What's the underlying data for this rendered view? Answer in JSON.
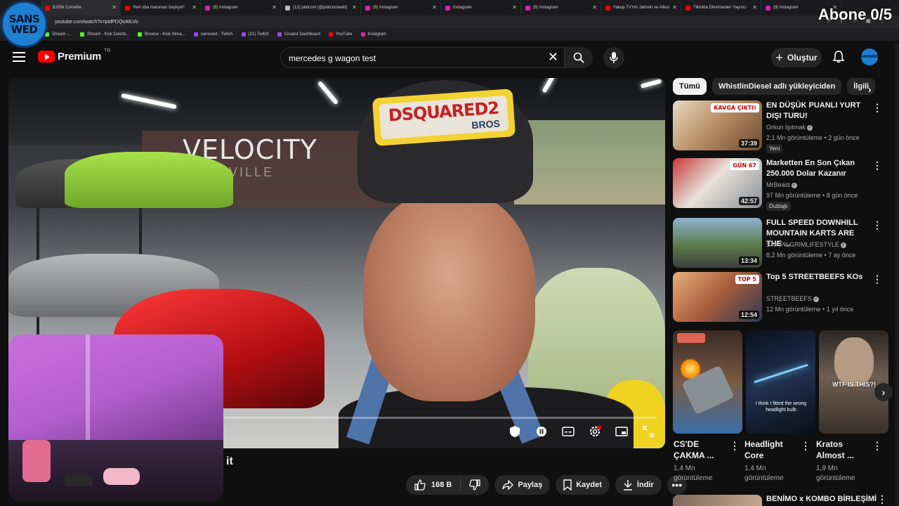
{
  "overlay": {
    "channel_logo_line1": "SANS",
    "channel_logo_line2": "WED",
    "subscriber_goal": "Abone 0/5"
  },
  "browser": {
    "tabs": [
      {
        "label": "$100k Corvette",
        "color": "#ff0000"
      },
      {
        "label": "Yeni oba macerası başlıyor!",
        "color": "#ff0000"
      },
      {
        "label": "(9) Instagram",
        "color": "#d6249f"
      },
      {
        "label": "(12) platcom (@platcomweb)",
        "color": "#bbbbbb"
      },
      {
        "label": "(9) Instagram",
        "color": "#d6249f"
      },
      {
        "label": "Instagram",
        "color": "#d6249f"
      },
      {
        "label": "(9) Instagram",
        "color": "#d6249f"
      },
      {
        "label": "Yakup TV'nin Jahrein ve Ailesi",
        "color": "#ff0000"
      },
      {
        "label": "Tiktokta Dilenmeden Yayıncı",
        "color": "#ff0000"
      },
      {
        "label": "(9) Instagram",
        "color": "#d6249f"
      }
    ],
    "url": "youtube.com/watch?v=pidPDQwMLVo",
    "bookmarks": [
      {
        "label": "Stream -...",
        "color": "#53fc18"
      },
      {
        "label": "Stream - Kick Dashb...",
        "color": "#53fc18"
      },
      {
        "label": "Browse - Kick Strea...",
        "color": "#53fc18"
      },
      {
        "label": "sanswed - Twitch",
        "color": "#9146ff"
      },
      {
        "label": "(21) Twitch",
        "color": "#9146ff"
      },
      {
        "label": "Creator Dashboard",
        "color": "#9146ff"
      },
      {
        "label": "YouTube",
        "color": "#ff0000"
      },
      {
        "label": "Instagram",
        "color": "#d6249f"
      }
    ]
  },
  "header": {
    "logo_text": "Premium",
    "region": "TR",
    "search_value": "mercedes g wagon test",
    "create_label": "Oluştur",
    "avatar_line1": "SANS",
    "avatar_line2": "WED"
  },
  "video": {
    "scene_sign": "VELOCITY",
    "scene_sign_sub": "NASHVILLE",
    "cap_text1": "DSQUARED2",
    "cap_text2": "BROS",
    "title_fragment": "it",
    "progress_fraction": 0.0
  },
  "actions": {
    "like_count": "168 B",
    "share_label": "Paylaş",
    "save_label": "Kaydet",
    "download_label": "İndir"
  },
  "sidebar": {
    "chips": [
      "Tümü",
      "WhistlinDiesel adlı yükleyiciden",
      "İlgili"
    ],
    "recommendations": [
      {
        "title": "EN DÜŞÜK PUANLI YURT DIŞI TURU!",
        "channel": "Orkun Işıtmak",
        "views": "2,1 Mn görüntüleme",
        "age": "2 gün önce",
        "duration": "37:39",
        "badge": "Yeni",
        "thumb_text": "KAVGA ÇIKTI!"
      },
      {
        "title": "Marketten En Son Çıkan 250.000 Dolar Kazanır",
        "channel": "MrBeast",
        "views": "97 Mn görüntüleme",
        "age": "8 gün önce",
        "duration": "42:57",
        "badge": "Dublajlı",
        "thumb_text": "GÜN 67"
      },
      {
        "title": "FULL SPEED DOWNHILL MOUNTAIN KARTS ARE THE ...",
        "channel": "SAMPILGRIMLIFESTYLE",
        "views": "8,2 Mn görüntüleme",
        "age": "7 ay önce",
        "duration": "13:34",
        "badge": "",
        "thumb_text": ""
      },
      {
        "title": "Top 5 STREETBEEFS KOs",
        "channel": "STREETBEEFS",
        "views": "12 Mn görüntüleme",
        "age": "1 yıl önce",
        "duration": "12:54",
        "badge": "",
        "thumb_text": "TOP 5"
      }
    ],
    "shorts": [
      {
        "title": "CS'DE ÇAKMA ...",
        "views_line1": "1,4 Mn",
        "views_line2": "görüntüleme",
        "thumb_text": ""
      },
      {
        "title": "Headlight Core",
        "views_line1": "1,4 Mn",
        "views_line2": "görüntüleme",
        "thumb_text": "I think I fitted the wrong headlight bulb"
      },
      {
        "title": "Kratos Almost ...",
        "views_line1": "1,9 Mn",
        "views_line2": "görüntüleme",
        "thumb_text": "WTF IS THIS?!"
      }
    ],
    "next_title": "BENİMO x KOMBO BİRLEŞİMİ"
  }
}
